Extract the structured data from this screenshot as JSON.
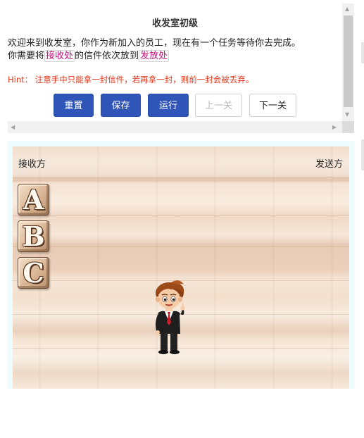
{
  "instructions": {
    "title": "收发室初级",
    "desc_part1": "欢迎来到收发室，你作为新加入的员工，现在有一个任务等待你去完成。",
    "desc_part2": "你需要将",
    "receive_label": "接收处",
    "desc_part3": "的信件依次放到",
    "send_label": "发放处",
    "hint": "Hint： 注意手中只能拿一封信件，若再拿一封，则前一封会被丢弃。"
  },
  "buttons": {
    "reset": "重置",
    "save": "保存",
    "run": "运行",
    "prev": "上一关",
    "next": "下一关"
  },
  "board": {
    "left_label": "接收方",
    "right_label": "发送方",
    "letters": [
      "A",
      "B",
      "C"
    ]
  },
  "colors": {
    "primary_button": "#2f55b8",
    "highlight_text": "#c0137e",
    "hint_text": "#e0371a"
  }
}
